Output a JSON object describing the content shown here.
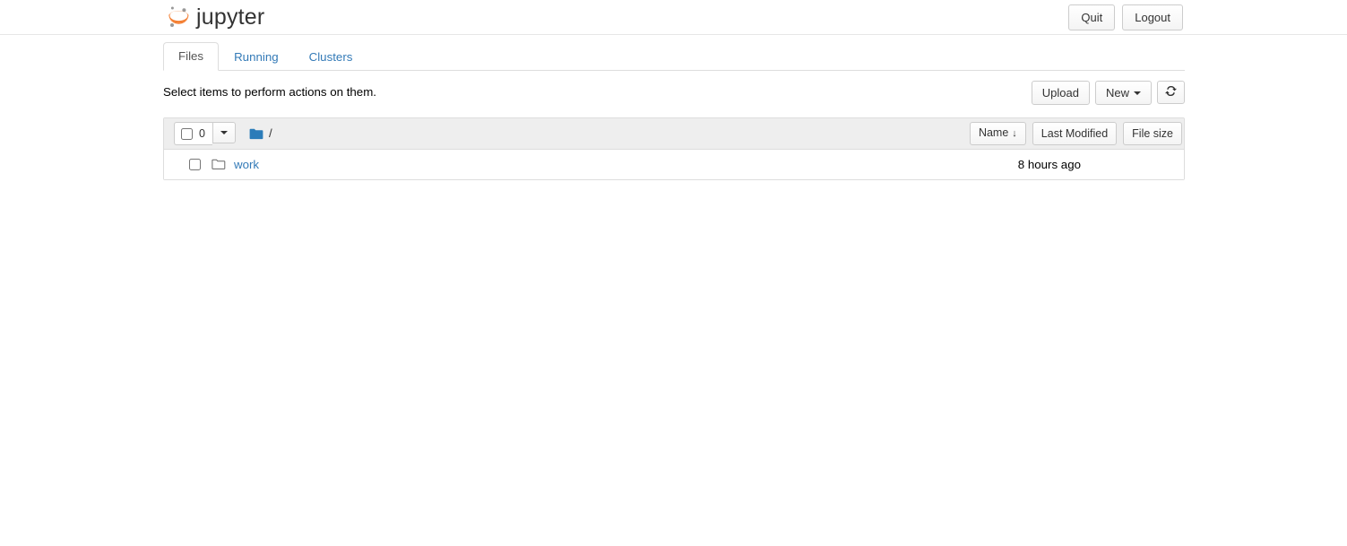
{
  "header": {
    "brand_title": "jupyter",
    "logo_icon": "jupyter-logo",
    "buttons": [
      {
        "label": "Quit",
        "name": "quit-button"
      },
      {
        "label": "Logout",
        "name": "logout-button"
      }
    ]
  },
  "tabs": [
    {
      "label": "Files",
      "active": true
    },
    {
      "label": "Running",
      "active": false
    },
    {
      "label": "Clusters",
      "active": false
    }
  ],
  "action_bar": {
    "message": "Select items to perform actions on them.",
    "upload_label": "Upload",
    "new_label": "New",
    "refresh_icon": "refresh-icon"
  },
  "list_toolbar": {
    "selected_count": "0",
    "select_all_checkbox": false,
    "dropdown_icon": "chevron-down-icon",
    "breadcrumb": {
      "folder_icon": "folder-icon",
      "path": "/"
    },
    "sort_buttons": [
      {
        "label": "Name",
        "arrow": "↓",
        "active": true
      },
      {
        "label": "Last Modified",
        "arrow": "",
        "active": false
      },
      {
        "label": "File size",
        "arrow": "",
        "active": false
      }
    ]
  },
  "file_list": {
    "rows": [
      {
        "icon": "folder-open-icon",
        "name": "work",
        "modified": "8 hours ago",
        "size": "",
        "checked": false
      }
    ]
  },
  "colors": {
    "link": "#337ab7",
    "logo_orange": "#f37726",
    "logo_gray": "#989898",
    "folder_blue": "#2b7cb9",
    "toolbar_bg": "#eeeeee",
    "border": "#dddddd"
  }
}
